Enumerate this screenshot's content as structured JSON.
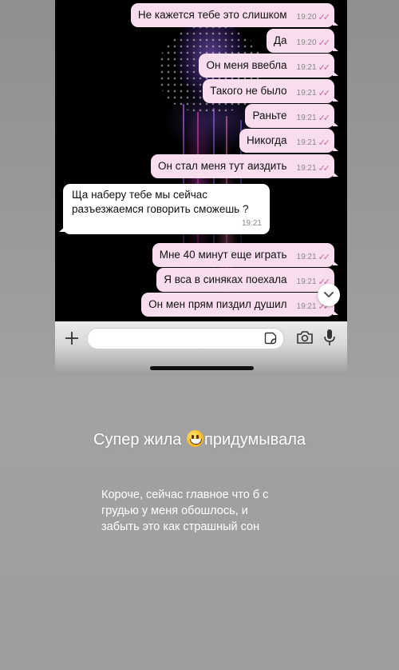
{
  "messages": [
    {
      "text": "Не кажется тебе это слишком",
      "time": "19:20",
      "dir": "out"
    },
    {
      "text": "Да",
      "time": "19:20",
      "dir": "out"
    },
    {
      "text": "Он меня ввебла",
      "time": "19:21",
      "dir": "out"
    },
    {
      "text": "Такого не было",
      "time": "19:21",
      "dir": "out"
    },
    {
      "text": "Раньте",
      "time": "19:21",
      "dir": "out"
    },
    {
      "text": "Никогда",
      "time": "19:21",
      "dir": "out"
    },
    {
      "text": "Он стал меня тут аиздить",
      "time": "19:21",
      "dir": "out"
    },
    {
      "lines": [
        "Ща наберу тебе мы сейчас",
        "разъезжаемся говорить сможешь ?"
      ],
      "time": "19:21",
      "dir": "in"
    },
    {
      "text": "Мне 40 минут еще играть",
      "time": "19:21",
      "dir": "out"
    },
    {
      "text": "Я вса в синяках поехала",
      "time": "19:21",
      "dir": "out"
    },
    {
      "text": "Он мен прям пиздил душил",
      "time": "19:21",
      "dir": "out"
    }
  ],
  "read_ticks": "✓✓",
  "input": {
    "placeholder": ""
  },
  "icons": {
    "plus": "plus-icon",
    "sticker": "sticker-icon",
    "camera": "camera-icon",
    "mic": "mic-icon",
    "scroll": "chevron-down-icon"
  },
  "caption": {
    "before": "Супер жила",
    "after": "придумывала"
  },
  "note": {
    "lines": [
      "Короче, сейчас главное что б с",
      "грудью у меня обошлось, и",
      "забыть это как страшный сон"
    ]
  },
  "colors": {
    "outgoing_bubble": "#f8ddef",
    "incoming_bubble": "#ffffff",
    "tick": "#c06aa0",
    "background": "#9a9a9a"
  }
}
